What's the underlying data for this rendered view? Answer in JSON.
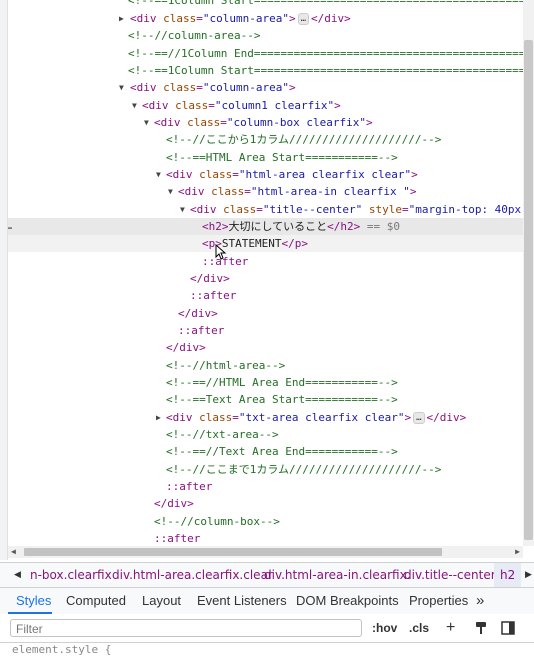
{
  "elements_tree": {
    "r0": {
      "cm": "<!--==1Column Start=================================================="
    },
    "r1": {
      "open": "<div ",
      "attr": "class",
      "val": "\"column-area\"",
      "close": ">",
      "ellipsis": "…",
      "end": "</div>"
    },
    "r2": {
      "cm": "<!--//column-area-->"
    },
    "r3": {
      "cm": "<!--==//1Column End=================================================="
    },
    "r4": {
      "cm": "<!--==1Column Start=================================================="
    },
    "r5": {
      "open": "<div ",
      "attr": "class",
      "val": "\"column-area\"",
      "close": ">"
    },
    "r6": {
      "open": "<div ",
      "attr": "class",
      "val": "\"column1 clearfix\"",
      "close": ">"
    },
    "r7": {
      "open": "<div ",
      "attr": "class",
      "val": "\"column-box clearfix\"",
      "close": ">"
    },
    "r8": {
      "cm": "<!--//ここから1カラム////////////////////-->"
    },
    "r9": {
      "cm": "<!--==HTML Area Start===========-->"
    },
    "r10": {
      "open": "<div ",
      "attr": "class",
      "val": "\"html-area clearfix clear\"",
      "close": ">"
    },
    "r11": {
      "open": "<div ",
      "attr": "class",
      "val": "\"html-area-in clearfix \"",
      "close": ">"
    },
    "r12": {
      "open": "<div ",
      "attr": "class",
      "val": "\"title--center\"",
      "attr2": "style",
      "val2": "\"margin-top: 40px;"
    },
    "r13": {
      "open": "<h2>",
      "text": "大切にしていること",
      "close": "</h2>",
      "eq": " == $0",
      "dots": "…"
    },
    "r14": {
      "open": "<p>",
      "text": "STATEMENT",
      "close": "</p>"
    },
    "r15": {
      "ps": "::after"
    },
    "r16": {
      "close": "</div>"
    },
    "r17": {
      "ps": "::after"
    },
    "r18": {
      "close": "</div>"
    },
    "r19": {
      "ps": "::after"
    },
    "r20": {
      "close": "</div>"
    },
    "r21": {
      "cm": "<!--//html-area-->"
    },
    "r22": {
      "cm": "<!--==//HTML Area End===========-->"
    },
    "r23": {
      "cm": "<!--==Text Area Start===========-->"
    },
    "r24": {
      "open": "<div ",
      "attr": "class",
      "val": "\"txt-area clearfix clear\"",
      "close": ">",
      "ellipsis": "…",
      "end": "</div>"
    },
    "r25": {
      "cm": "<!--//txt-area-->"
    },
    "r26": {
      "cm": "<!--==//Text Area End===========-->"
    },
    "r27": {
      "cm": "<!--//ここまで1カラム////////////////////-->"
    },
    "r28": {
      "ps": "::after"
    },
    "r29": {
      "close": "</div>"
    },
    "r30": {
      "cm": "<!--//column-box-->"
    },
    "r31": {
      "ps": "::after"
    }
  },
  "breadcrumbs": {
    "left_arrow": "◀",
    "right_arrow": "▶",
    "items": [
      "n-box.clearfix",
      "div.html-area.clearfix.clear",
      "div.html-area-in.clearfix.",
      "div.title--center",
      "h2"
    ]
  },
  "tabs": {
    "items": [
      "Styles",
      "Computed",
      "Layout",
      "Event Listeners",
      "DOM Breakpoints",
      "Properties"
    ],
    "more": "»"
  },
  "filter": {
    "placeholder": "Filter",
    "hov": ":hov",
    "cls": ".cls",
    "plus": "+",
    "paint_icon": "paint-brush-icon",
    "sidebar_icon": "toggle-sidebar-icon"
  },
  "styles_pane": {
    "element_style": "element.style {"
  },
  "colors": {
    "tag": "#881280",
    "attr_name": "#994500",
    "attr_value": "#1a1aa6",
    "comment": "#236e25",
    "active_tab": "#1a73e8"
  }
}
